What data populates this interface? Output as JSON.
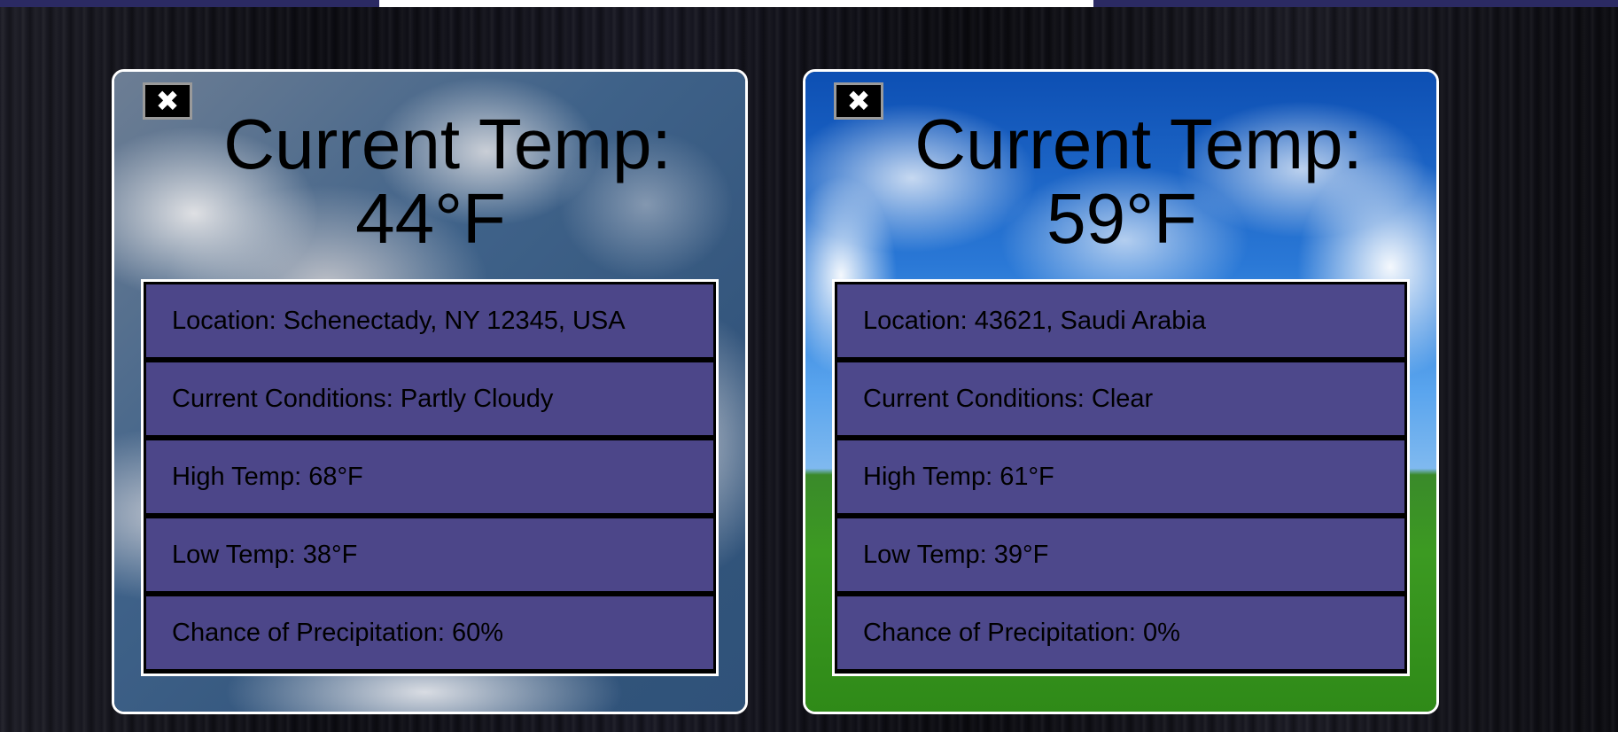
{
  "cards": [
    {
      "close_label": "✖",
      "title_label": "Current Temp:",
      "title_value": "44°F",
      "location": "Location: Schenectady, NY 12345, USA",
      "conditions": "Current Conditions: Partly Cloudy",
      "high": "High Temp: 68°F",
      "low": "Low Temp: 38°F",
      "precip": "Chance of Precipitation: 60%"
    },
    {
      "close_label": "✖",
      "title_label": "Current Temp:",
      "title_value": "59°F",
      "location": "Location: 43621, Saudi Arabia",
      "conditions": "Current Conditions: Clear",
      "high": "High Temp: 61°F",
      "low": "Low Temp: 39°F",
      "precip": "Chance of Precipitation: 0%"
    }
  ],
  "colors": {
    "topbar": "#2b2a63",
    "row_fill": "#5852a0",
    "card_border": "#ffffff"
  }
}
